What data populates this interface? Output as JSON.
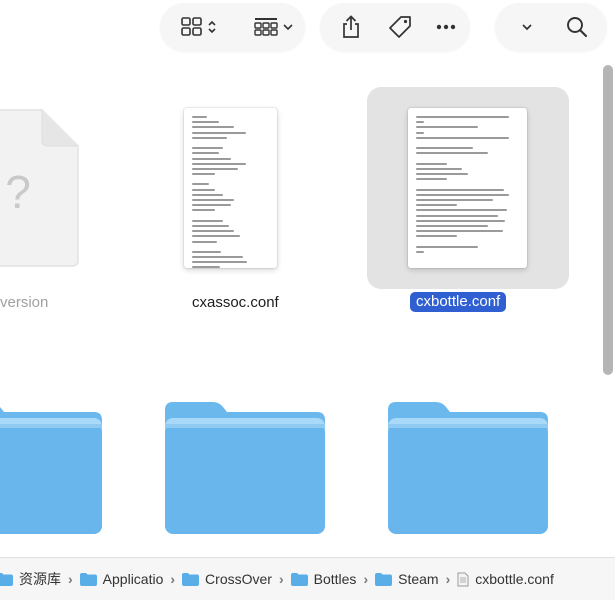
{
  "toolbar": {
    "view_icon_grid": "grid-view-icon",
    "group_icon": "group-by-icon",
    "share_icon": "share-icon",
    "tag_icon": "tag-icon",
    "more_icon": "more-icon",
    "chevron_icon": "chevron-down-icon",
    "search_icon": "search-icon"
  },
  "files": [
    {
      "name": "version",
      "kind": "generic"
    },
    {
      "name": "cxassoc.conf",
      "kind": "document"
    },
    {
      "name": "cxbottle.conf",
      "kind": "document",
      "selected": true
    }
  ],
  "folders": [
    {
      "name": ""
    },
    {
      "name": ""
    },
    {
      "name": ""
    }
  ],
  "pathbar": {
    "items": [
      {
        "label": "资源库",
        "icon": "folder-icon"
      },
      {
        "label": "Applicatio",
        "icon": "folder-icon"
      },
      {
        "label": "CrossOver",
        "icon": "folder-icon"
      },
      {
        "label": "Bottles",
        "icon": "folder-icon"
      },
      {
        "label": "Steam",
        "icon": "folder-icon"
      },
      {
        "label": "cxbottle.conf",
        "icon": "file-icon"
      }
    ],
    "separator": "›"
  },
  "colors": {
    "folder_light": "#a8d8f8",
    "folder_main": "#6bb8ec",
    "selection": "#2f5fd0"
  }
}
